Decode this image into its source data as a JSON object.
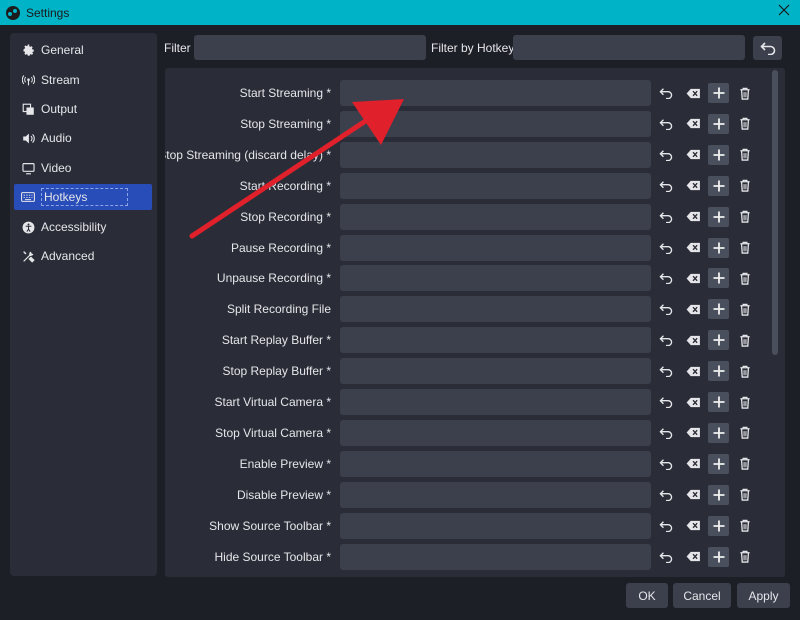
{
  "window": {
    "title": "Settings",
    "accent_color": "#00b3c7"
  },
  "sidebar": {
    "items": [
      {
        "label": "General",
        "icon": "gear-icon"
      },
      {
        "label": "Stream",
        "icon": "broadcast-icon"
      },
      {
        "label": "Output",
        "icon": "output-icon"
      },
      {
        "label": "Audio",
        "icon": "speaker-icon"
      },
      {
        "label": "Video",
        "icon": "monitor-icon"
      },
      {
        "label": "Hotkeys",
        "icon": "keyboard-icon",
        "active": true
      },
      {
        "label": "Accessibility",
        "icon": "accessibility-icon"
      },
      {
        "label": "Advanced",
        "icon": "tools-icon"
      }
    ]
  },
  "filter": {
    "label": "Filter",
    "value": "",
    "hotkey_label": "Filter by Hotkey",
    "hotkey_value": ""
  },
  "hotkeys": {
    "rows": [
      {
        "label": "Start Streaming *",
        "value": ""
      },
      {
        "label": "Stop Streaming *",
        "value": ""
      },
      {
        "label": "Stop Streaming (discard delay) *",
        "value": ""
      },
      {
        "label": "Start Recording *",
        "value": ""
      },
      {
        "label": "Stop Recording *",
        "value": ""
      },
      {
        "label": "Pause Recording *",
        "value": ""
      },
      {
        "label": "Unpause Recording *",
        "value": ""
      },
      {
        "label": "Split Recording File",
        "value": ""
      },
      {
        "label": "Start Replay Buffer *",
        "value": ""
      },
      {
        "label": "Stop Replay Buffer *",
        "value": ""
      },
      {
        "label": "Start Virtual Camera *",
        "value": ""
      },
      {
        "label": "Stop Virtual Camera *",
        "value": ""
      },
      {
        "label": "Enable Preview *",
        "value": ""
      },
      {
        "label": "Disable Preview *",
        "value": ""
      },
      {
        "label": "Show Source Toolbar *",
        "value": ""
      },
      {
        "label": "Hide Source Toolbar *",
        "value": ""
      }
    ]
  },
  "annotation": {
    "color": "#e0202a"
  },
  "buttons": {
    "ok": "OK",
    "cancel": "Cancel",
    "apply": "Apply"
  }
}
